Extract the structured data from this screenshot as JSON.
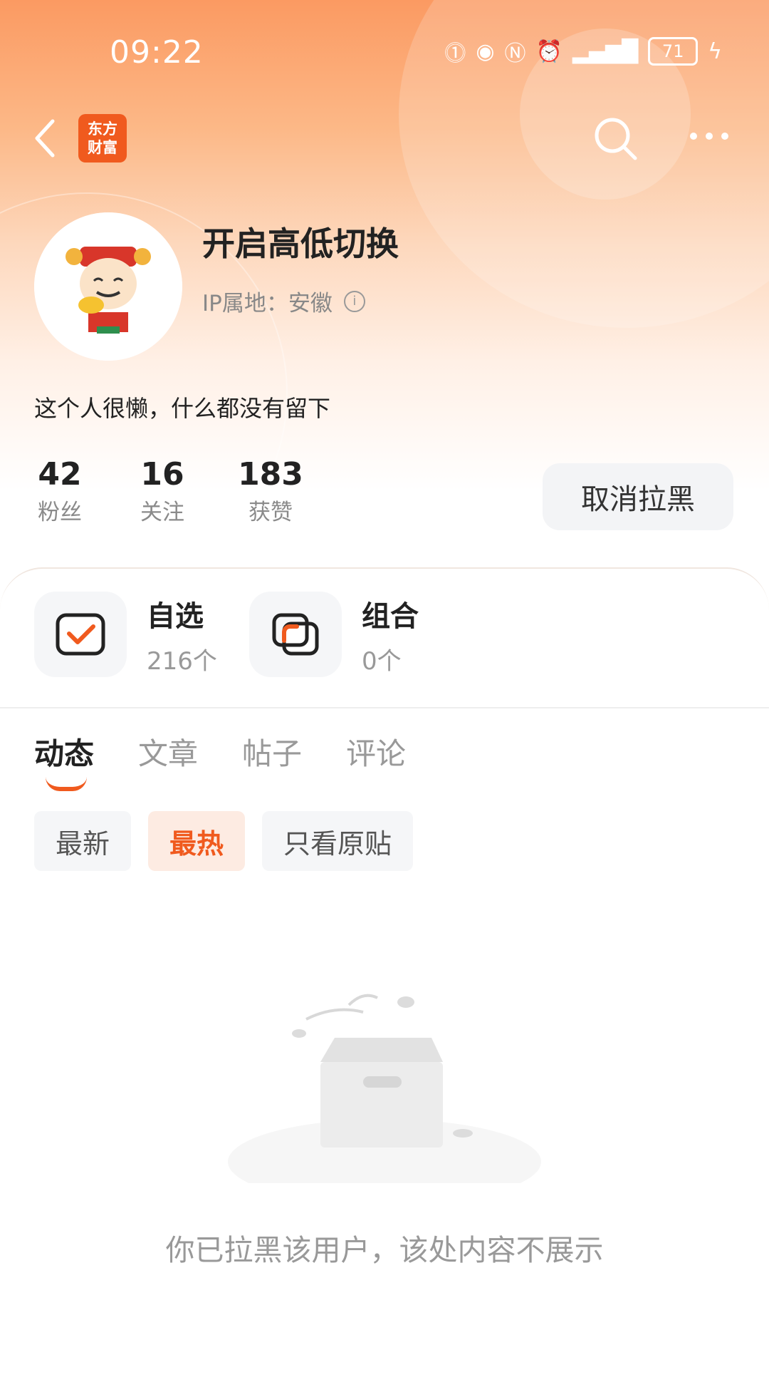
{
  "status_bar": {
    "time": "09:22",
    "battery": "71"
  },
  "header": {
    "logo_text_line1": "东方",
    "logo_text_line2": "财富"
  },
  "profile": {
    "name": "开启高低切换",
    "ip_label": "IP属地：安徽",
    "bio": "这个人很懒，什么都没有留下"
  },
  "stats": [
    {
      "value": "42",
      "label": "粉丝"
    },
    {
      "value": "16",
      "label": "关注"
    },
    {
      "value": "183",
      "label": "获赞"
    }
  ],
  "unblock_button": "取消拉黑",
  "features": [
    {
      "title": "自选",
      "sub": "216个"
    },
    {
      "title": "组合",
      "sub": "0个"
    }
  ],
  "tabs": [
    "动态",
    "文章",
    "帖子",
    "评论"
  ],
  "filters": [
    "最新",
    "最热",
    "只看原贴"
  ],
  "empty_message": "你已拉黑该用户，该处内容不展示",
  "colors": {
    "accent": "#f05a1e",
    "header_gradient_top": "#fb9a62"
  }
}
